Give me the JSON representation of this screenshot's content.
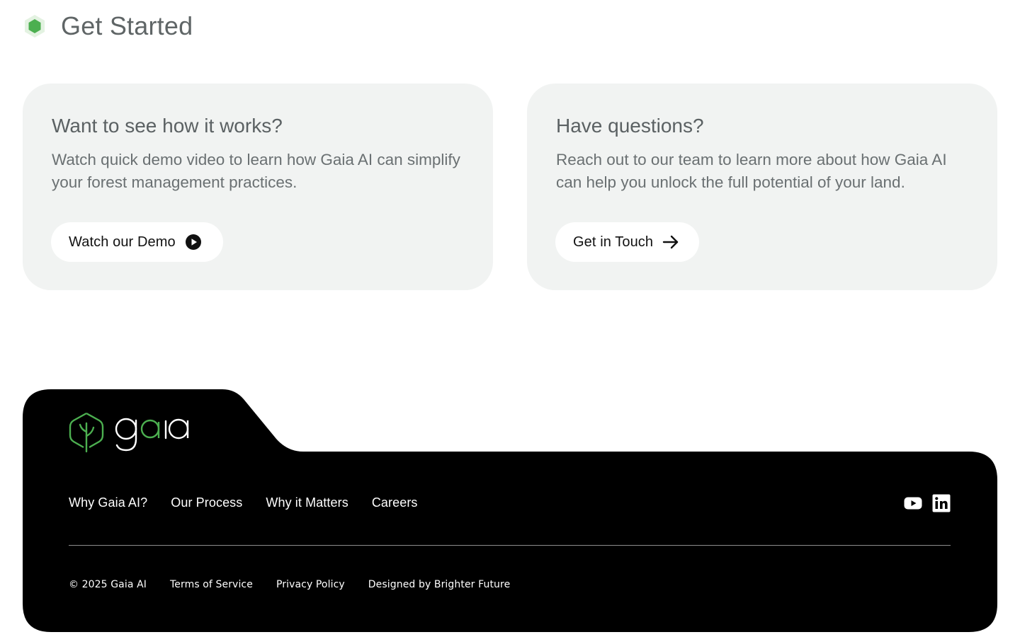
{
  "section": {
    "title": "Get Started",
    "icon": "hexagon-icon"
  },
  "cards": {
    "demo": {
      "title": "Want to see how it works?",
      "text": "Watch quick demo video to learn how Gaia AI can simplify your forest management practices.",
      "button_label": "Watch our Demo",
      "button_icon": "play-circle-icon"
    },
    "contact": {
      "title": "Have questions?",
      "text": "Reach out to our team to learn more about how Gaia AI can help you unlock the full potential of your land.",
      "button_label": "Get in Touch",
      "button_icon": "arrow-right-icon"
    }
  },
  "footer": {
    "logo_text": "gaia",
    "nav": [
      "Why Gaia AI?",
      "Our Process",
      "Why it Matters",
      "Careers"
    ],
    "socials": [
      "youtube-icon",
      "linkedin-icon"
    ],
    "copyright": "© 2025 Gaia AI",
    "legal_links": [
      "Terms of Service",
      "Privacy Policy",
      "Designed by Brighter Future"
    ]
  },
  "colors": {
    "accent_green": "#4caf50",
    "card_bg": "#f1f3f2",
    "footer_bg": "#000000"
  }
}
